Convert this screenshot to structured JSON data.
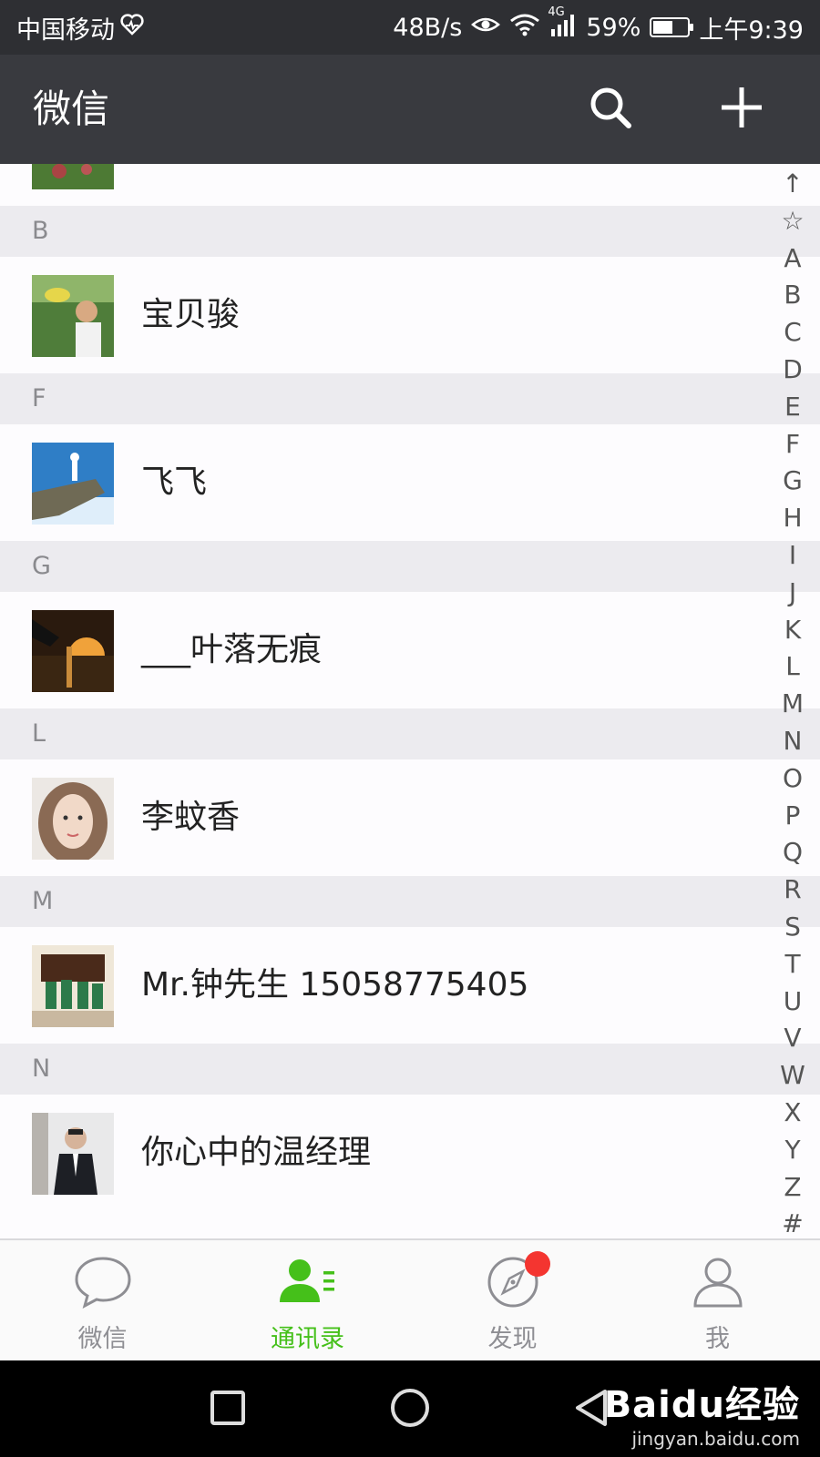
{
  "status_bar": {
    "carrier": "中国移动",
    "net_speed": "48B/s",
    "network_type": "4G",
    "battery": "59%",
    "battery_level": 0.59,
    "time": "上午9:39"
  },
  "app_bar": {
    "title": "微信",
    "search_icon": "search-icon",
    "add_icon": "plus-icon"
  },
  "contacts": {
    "sections": [
      {
        "letter": "B",
        "items": [
          {
            "name": "宝贝骏",
            "avatar": "child-photo"
          }
        ]
      },
      {
        "letter": "F",
        "items": [
          {
            "name": "飞飞",
            "avatar": "bird-on-cliff-photo"
          }
        ]
      },
      {
        "letter": "G",
        "items": [
          {
            "name": "___叶落无痕",
            "avatar": "sunset-hand-photo"
          }
        ]
      },
      {
        "letter": "L",
        "items": [
          {
            "name": "李蚊香",
            "avatar": "woman-portrait-photo"
          }
        ]
      },
      {
        "letter": "M",
        "items": [
          {
            "name": "Mr.钟先生 15058775405",
            "avatar": "soccer-team-photo"
          }
        ]
      },
      {
        "letter": "N",
        "items": [
          {
            "name": "你心中的温经理",
            "avatar": "man-in-suit-photo"
          }
        ]
      }
    ]
  },
  "index_bar": [
    "↑",
    "☆",
    "A",
    "B",
    "C",
    "D",
    "E",
    "F",
    "G",
    "H",
    "I",
    "J",
    "K",
    "L",
    "M",
    "N",
    "O",
    "P",
    "Q",
    "R",
    "S",
    "T",
    "U",
    "V",
    "W",
    "X",
    "Y",
    "Z",
    "#"
  ],
  "tab_bar": {
    "tabs": [
      {
        "label": "微信",
        "icon": "chat-bubble-icon",
        "active": false
      },
      {
        "label": "通讯录",
        "icon": "contacts-icon",
        "active": true
      },
      {
        "label": "发现",
        "icon": "compass-icon",
        "active": false,
        "badge": true
      },
      {
        "label": "我",
        "icon": "person-icon",
        "active": false
      }
    ]
  },
  "colors": {
    "accent": "#45c01a",
    "header": "#393a3f",
    "status_bar": "#2e2f33",
    "badge": "#f43530"
  },
  "watermark": {
    "brand": "Baidu经验",
    "url": "jingyan.baidu.com"
  }
}
